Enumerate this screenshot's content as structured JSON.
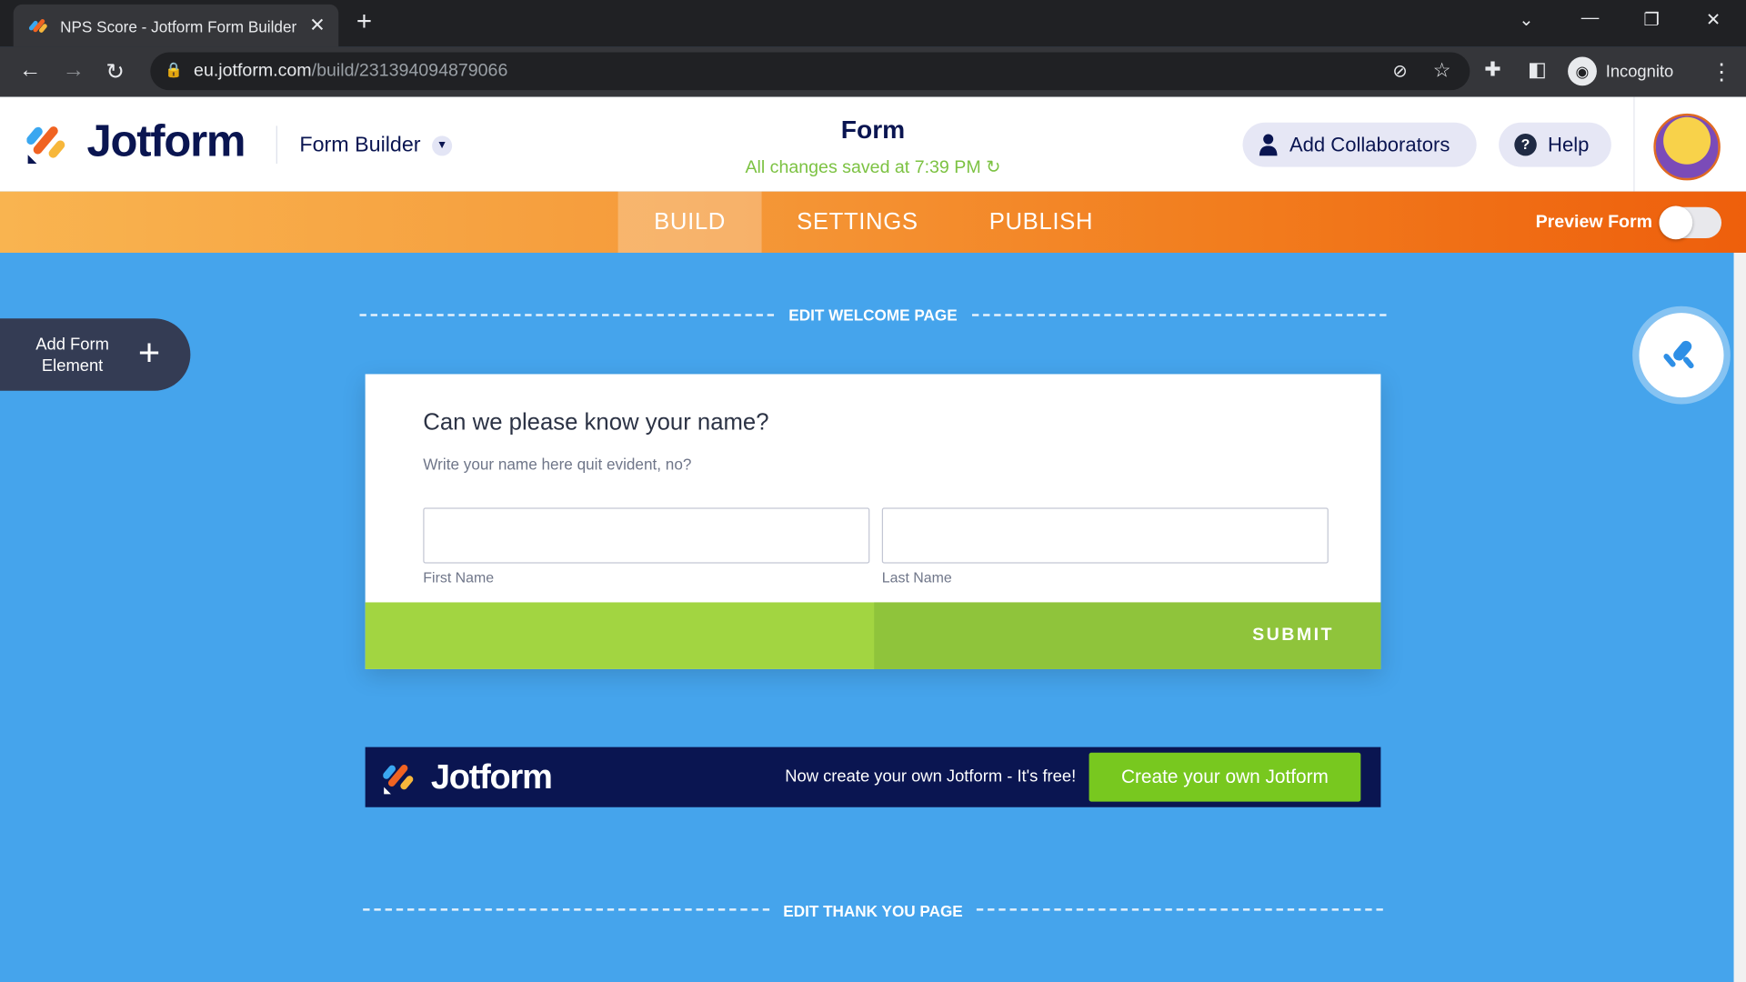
{
  "browser": {
    "tab_title": "NPS Score - Jotform Form Builder",
    "url_host": "eu.jotform.com",
    "url_path": "/build/231394094879066",
    "profile": "Incognito"
  },
  "header": {
    "logo": "Jotform",
    "builder_label": "Form Builder",
    "form_title": "Form",
    "save_status": "All changes saved at 7:39 PM",
    "add_collaborators": "Add Collaborators",
    "help": "Help"
  },
  "nav": {
    "tabs": [
      {
        "label": "BUILD",
        "active": true
      },
      {
        "label": "SETTINGS"
      },
      {
        "label": "PUBLISH"
      }
    ],
    "preview_label": "Preview Form",
    "preview_on": false
  },
  "canvas": {
    "edit_welcome": "EDIT WELCOME PAGE",
    "edit_thankyou": "EDIT THANK YOU PAGE",
    "add_element": "Add Form Element"
  },
  "question": {
    "title": "Can we please know your name?",
    "subtitle": "Write your name here quit evident, no?",
    "first_label": "First Name",
    "last_label": "Last Name",
    "first_value": "",
    "last_value": "",
    "submit": "SUBMIT"
  },
  "banner": {
    "logo": "Jotform",
    "text": "Now create your own Jotform - It's free!",
    "cta": "Create your own Jotform"
  },
  "colors": {
    "canvas": "#45a4ec",
    "navy": "#0a1551",
    "submit": "#a2d541",
    "cta": "#78c81f",
    "saved": "#7cc242"
  }
}
